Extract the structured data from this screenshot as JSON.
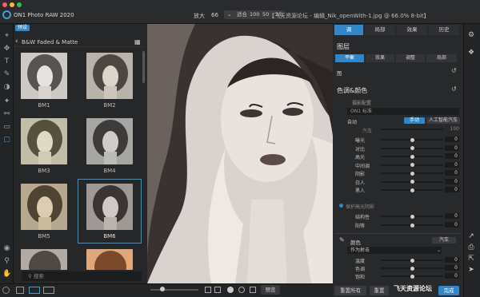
{
  "window": {
    "app_title": "ON1 Photo RAW 2020",
    "doc_title": "【飞天资源论坛 - 编辑_Nik_openWith-1.jpg @ 66.0% 8-bit】"
  },
  "zoom": {
    "label": "放大",
    "value": "66",
    "fit_label": "适合",
    "levels": [
      "100",
      "50",
      "25"
    ]
  },
  "presets": {
    "tab_label": "预设",
    "category": "B&W Faded & Matte",
    "items": [
      "BM1",
      "BM2",
      "BM3",
      "BM4",
      "BM5",
      "BM6"
    ],
    "selected": "BM6",
    "search_placeholder": "搜索"
  },
  "right_tabs": [
    "调",
    "局部",
    "效果",
    "历史"
  ],
  "layers": {
    "title": "图层",
    "subtabs": [
      "平衡",
      "效果",
      "调整",
      "局部"
    ],
    "row_label": "图"
  },
  "color_tone": {
    "title": "色调&颜色",
    "profile_label": "摄影配置",
    "profile_value": "ON1 标准",
    "mode_label": "自动",
    "auto_btn": "手动",
    "ai_btn": "人工智能汽车",
    "auto_row_label": "汽车",
    "auto_row_value": "100",
    "sliders": [
      {
        "label": "曝光",
        "value": "0",
        "pos": 0.5
      },
      {
        "label": "对比",
        "value": "0",
        "pos": 0.5
      },
      {
        "label": "高光",
        "value": "0",
        "pos": 0.5
      },
      {
        "label": "中间调",
        "value": "0",
        "pos": 0.5
      },
      {
        "label": "阴影",
        "value": "0",
        "pos": 0.5
      },
      {
        "label": "白人",
        "value": "0",
        "pos": 0.5
      },
      {
        "label": "黑人",
        "value": "0",
        "pos": 0.5
      }
    ],
    "protect_label": "保护高光阴影",
    "sliders2": [
      {
        "label": "结构性",
        "value": "0",
        "pos": 0.5
      },
      {
        "label": "阳等",
        "value": "0",
        "pos": 0.5
      }
    ]
  },
  "color": {
    "label": "颜色",
    "auto_btn": "汽车",
    "mode_value": "作为射击",
    "sliders": [
      {
        "label": "温度",
        "value": "0",
        "pos": 0.5
      },
      {
        "label": "色调",
        "value": "0",
        "pos": 0.5
      },
      {
        "label": "饱和",
        "value": "0",
        "pos": 0.5
      }
    ]
  },
  "bottom": {
    "preview_btn": "预览",
    "reset_all": "重置所有",
    "reset": "重置",
    "done": "完成"
  },
  "watermark": "飞天资源论坛",
  "colors": {
    "accent": "#2e96cf"
  }
}
